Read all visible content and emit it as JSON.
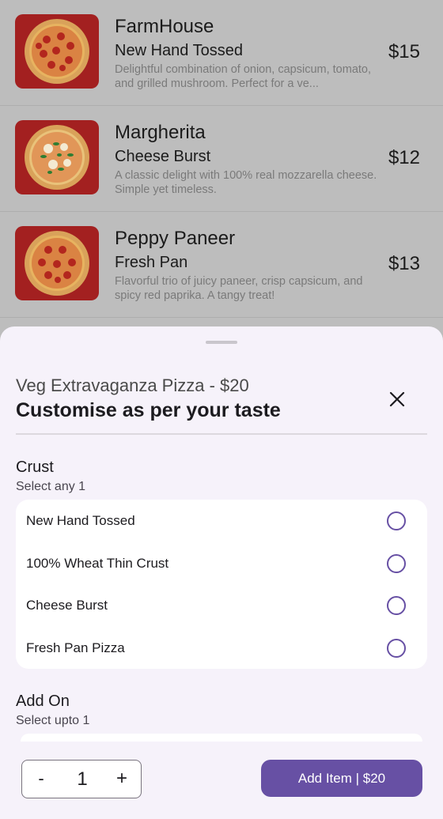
{
  "menu": {
    "items": [
      {
        "name": "FarmHouse",
        "variant": "New Hand Tossed",
        "description": "Delightful combination of onion, capsicum, tomato, and grilled mushroom. Perfect for a ve...",
        "price": "$15"
      },
      {
        "name": "Margherita",
        "variant": "Cheese Burst",
        "description": "A classic delight with 100% real mozzarella cheese. Simple yet timeless.",
        "price": "$12"
      },
      {
        "name": "Peppy Paneer",
        "variant": "Fresh Pan",
        "description": "Flavorful trio of juicy paneer, crisp capsicum, and spicy red paprika. A tangy treat!",
        "price": "$13"
      }
    ]
  },
  "sheet": {
    "pizza_title": "Veg Extravaganza Pizza - $20",
    "heading": "Customise as per your taste",
    "crust": {
      "title": "Crust",
      "subtitle": "Select any 1",
      "options": [
        "New Hand Tossed",
        "100% Wheat Thin Crust",
        "Cheese Burst",
        "Fresh Pan Pizza"
      ]
    },
    "addon": {
      "title": "Add On",
      "subtitle": "Select upto 1"
    }
  },
  "footer": {
    "minus_label": "-",
    "quantity": "1",
    "plus_label": "+",
    "add_button_label": "Add Item | $20"
  },
  "colors": {
    "accent": "#6750a4",
    "scrim": "#bdbdbd",
    "sheet_background": "#f6f2fa",
    "thumb_background": "#a32020"
  },
  "icons": {
    "close": "close-icon",
    "pizza": "pizza-image"
  }
}
